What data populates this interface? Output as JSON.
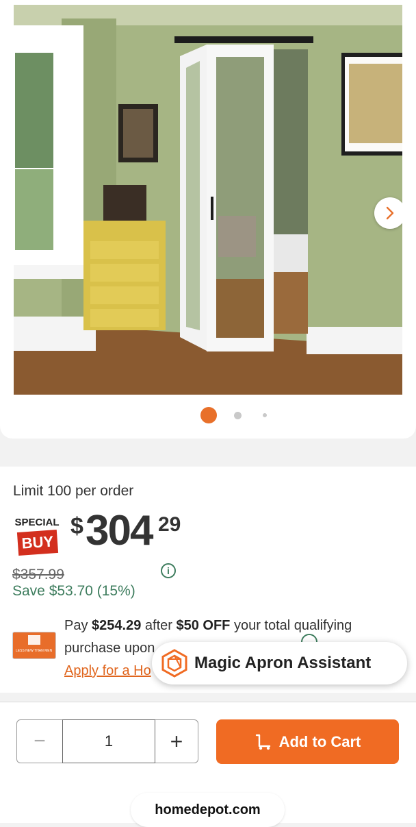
{
  "gallery": {
    "image_alt": "White mirrored bifold barn door in green room",
    "active_dot_color": "#e8702a",
    "inactive_dot_color": "#c9c9c9",
    "next_icon": "chevron-right-icon"
  },
  "pricing": {
    "limit_text": "Limit 100 per order",
    "badge_top": "SPECIAL",
    "badge_bottom": "BUY",
    "currency": "$",
    "dollars": "304",
    "cents": "29",
    "was_price": "$357.99",
    "save_text": "Save $53.70 (15%)",
    "info_icon": "info-icon"
  },
  "promo": {
    "pay_word": "Pay",
    "pay_amount": "$254.29",
    "after_word": "after",
    "off_amount": "$50 OFF",
    "rest_text": "your total qualifying purchase upon",
    "apply_link": "Apply for a Ho",
    "card_text": "LESS NEW THAN MEN"
  },
  "assistant": {
    "label": "Magic Apron Assistant",
    "icon": "hexagon-apron-icon"
  },
  "cart": {
    "quantity": "1",
    "minus_label": "−",
    "plus_label": "+",
    "add_label": "Add to Cart",
    "cart_icon": "dolly-cart-icon",
    "accent": "#f06b23"
  },
  "browser": {
    "url": "homedepot.com"
  }
}
